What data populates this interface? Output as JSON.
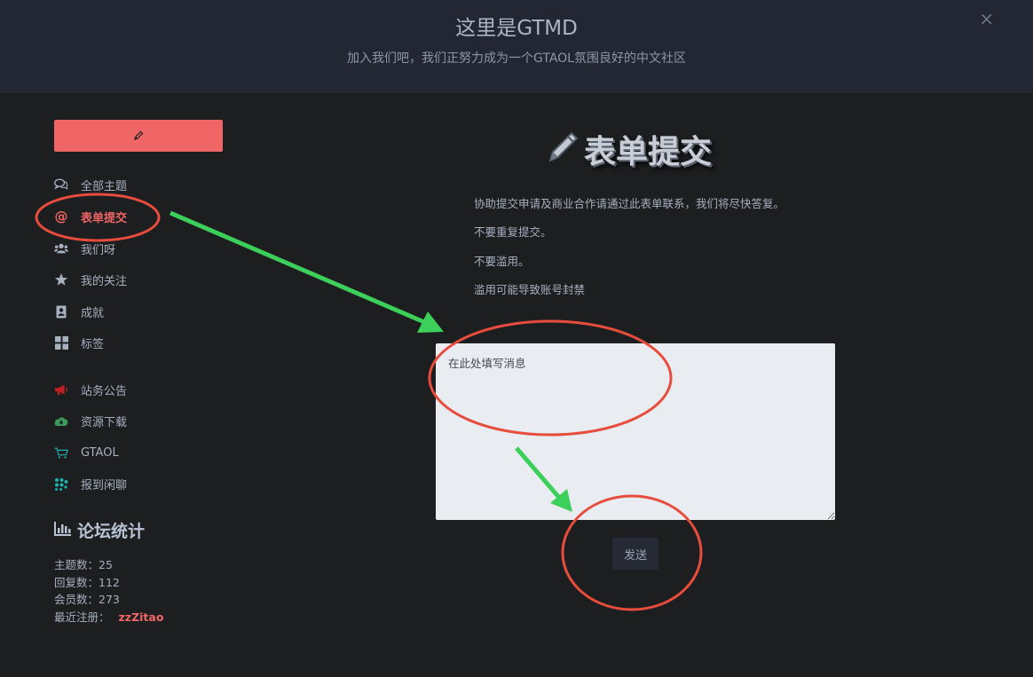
{
  "hero": {
    "title": "这里是GTMD",
    "subtitle": "加入我们吧，我们正努力成为一个GTAOL氛围良好的中文社区",
    "close_glyph": "×"
  },
  "sidebar": {
    "compose_icon": "pencil-icon",
    "items": [
      {
        "label": "全部主题",
        "icon": "comments-icon"
      },
      {
        "label": "表单提交",
        "icon": "at-icon",
        "active": true
      },
      {
        "label": "我们呀",
        "icon": "users-icon"
      },
      {
        "label": "我的关注",
        "icon": "star-icon"
      },
      {
        "label": "成就",
        "icon": "badge-icon"
      },
      {
        "label": "标签",
        "icon": "tags-grid-icon"
      },
      {
        "label": "站务公告",
        "icon": "megaphone-icon"
      },
      {
        "label": "资源下载",
        "icon": "cloud-download-icon"
      },
      {
        "label": "GTAOL",
        "icon": "cart-icon"
      },
      {
        "label": "报到闲聊",
        "icon": "chat-dots-icon"
      }
    ]
  },
  "stats": {
    "title": "论坛统计",
    "topics_label": "主题数：",
    "topics_value": "25",
    "replies_label": "回复数：",
    "replies_value": "112",
    "members_label": "会员数：",
    "members_value": "273",
    "latest_label": "最近注册：",
    "latest_user": "zzZitao"
  },
  "main": {
    "heading": "表单提交",
    "lines": [
      "协助提交申请及商业合作请通过此表单联系，我们将尽快答复。",
      "不要重复提交。",
      "不要滥用。",
      "滥用可能导致账号封禁"
    ],
    "message_placeholder": "在此处填写消息",
    "send_label": "发送"
  },
  "colors": {
    "accent": "#f06565",
    "annotation_red": "#e74c3c",
    "annotation_green": "#3ccf5a",
    "hero_bg": "#232733",
    "page_bg": "#1d1e20"
  }
}
